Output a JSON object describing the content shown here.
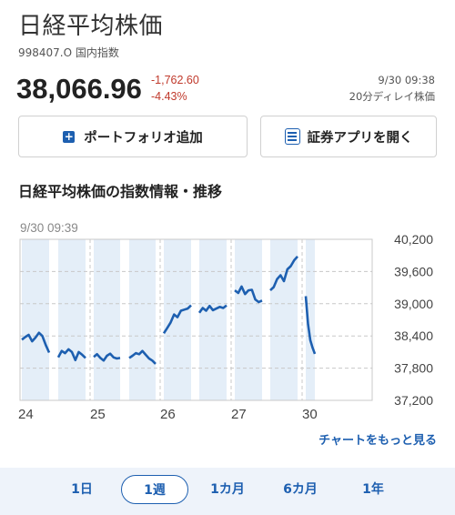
{
  "header": {
    "title": "日経平均株価",
    "code": "998407.O  国内指数",
    "price": "38,066.96",
    "change_abs": "-1,762.60",
    "change_pct": "-4.43%",
    "time": "9/30 09:38",
    "delay": "20分ディレイ株価"
  },
  "buttons": {
    "portfolio": "ポートフォリオ追加",
    "app": "証券アプリを開く"
  },
  "section": {
    "title": "日経平均株価の指数情報・推移"
  },
  "chart_data": {
    "type": "line",
    "time_label": "9/30 09:39",
    "y_ticks": [
      "40,200",
      "39,600",
      "39,000",
      "38,400",
      "37,800",
      "37,200"
    ],
    "x_ticks": [
      "24",
      "25",
      "26",
      "27",
      "30"
    ],
    "ylim": [
      37200,
      40200
    ],
    "grid": true,
    "session_shading": true,
    "sessions": [
      [
        38330,
        38380,
        38420,
        38300,
        38370,
        38460,
        38400,
        38230,
        38090
      ],
      [
        38000,
        38120,
        38080,
        38150,
        38100,
        37950,
        38100,
        38050,
        37990
      ],
      [
        38010,
        38060,
        37990,
        37940,
        38030,
        38070,
        38000,
        37980,
        37990
      ],
      [
        37990,
        38030,
        38080,
        38060,
        38120,
        38050,
        37980,
        37940,
        37880
      ],
      [
        38450,
        38550,
        38650,
        38800,
        38750,
        38870,
        38890,
        38910,
        38970
      ],
      [
        38830,
        38920,
        38870,
        38960,
        38880,
        38910,
        38940,
        38920,
        38970
      ],
      [
        39250,
        39200,
        39320,
        39180,
        39250,
        39260,
        39080,
        39030,
        39060
      ],
      [
        39250,
        39310,
        39460,
        39530,
        39420,
        39640,
        39700,
        39810,
        39880
      ],
      [
        39140,
        38620,
        38320,
        38180,
        38066
      ]
    ]
  },
  "links": {
    "more": "チャートをもっと見る"
  },
  "tabs": [
    "1日",
    "1週",
    "1カ月",
    "6カ月",
    "1年"
  ],
  "active_tab": "1週",
  "colors": {
    "line": "#1d5fb0",
    "shade": "#e4eef8",
    "negative": "#c0392b"
  }
}
